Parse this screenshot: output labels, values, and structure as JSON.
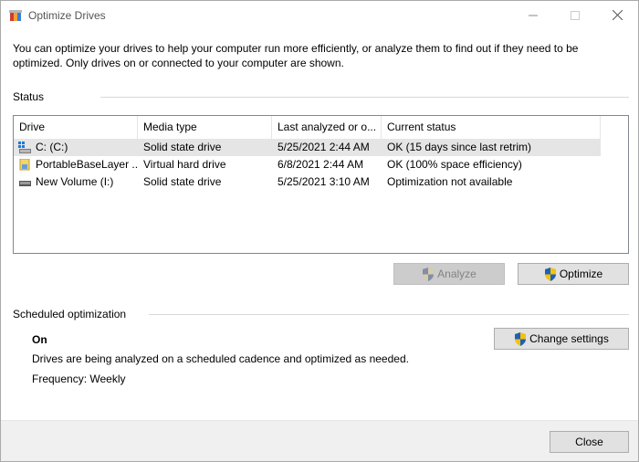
{
  "window": {
    "title": "Optimize Drives"
  },
  "description": "You can optimize your drives to help your computer run more efficiently, or analyze them to find out if they need to be optimized. Only drives on or connected to your computer are shown.",
  "status": {
    "label": "Status",
    "columns": [
      "Drive",
      "Media type",
      "Last analyzed or o...",
      "Current status"
    ],
    "rows": [
      {
        "drive": "C: (C:)",
        "icon": "system-drive-icon",
        "media": "Solid state drive",
        "last": "5/25/2021 2:44 AM",
        "status": "OK (15 days since last retrim)"
      },
      {
        "drive": "PortableBaseLayer ...",
        "icon": "virtual-drive-icon",
        "media": "Virtual hard drive",
        "last": "6/8/2021 2:44 AM",
        "status": "OK (100% space efficiency)"
      },
      {
        "drive": "New Volume (I:)",
        "icon": "drive-icon",
        "media": "Solid state drive",
        "last": "5/25/2021 3:10 AM",
        "status": "Optimization not available"
      }
    ]
  },
  "buttons": {
    "analyze": "Analyze",
    "optimize": "Optimize",
    "change_settings": "Change settings",
    "close": "Close"
  },
  "scheduled": {
    "label": "Scheduled optimization",
    "state": "On",
    "details": "Drives are being analyzed on a scheduled cadence and optimized as needed.",
    "frequency": "Frequency: Weekly"
  },
  "colors": {
    "selected_row": "#e5e5e5",
    "button_face": "#e1e1e1",
    "shield_blue": "#1f5fb6",
    "shield_yellow": "#f4c20d"
  }
}
